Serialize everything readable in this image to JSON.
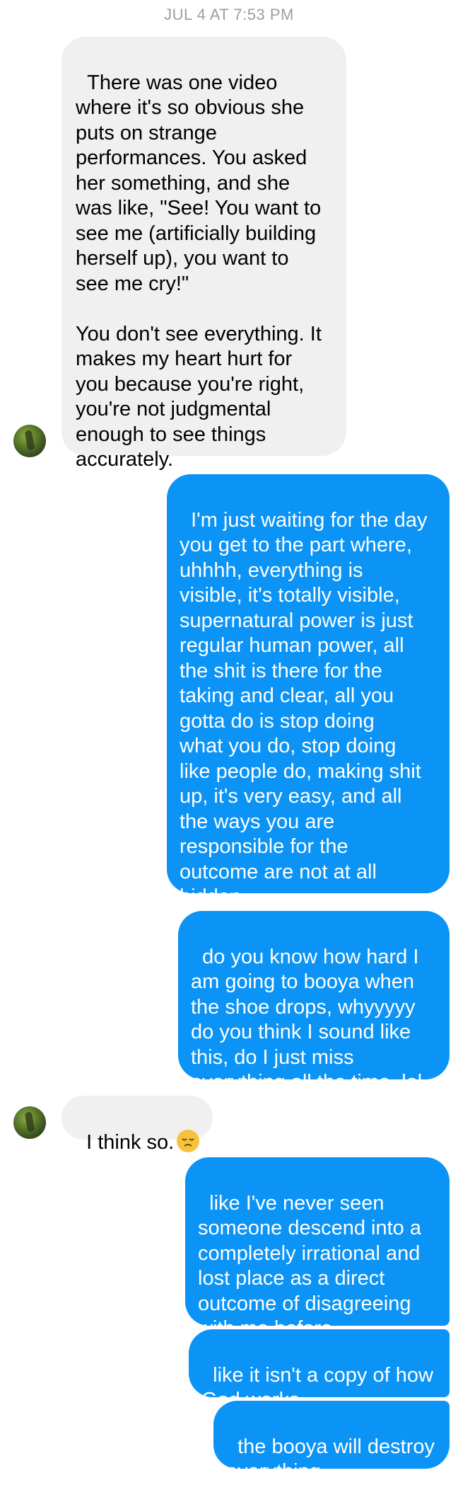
{
  "thread": {
    "timestamp": "JUL 4 AT 7:53 PM"
  },
  "messages": [
    {
      "direction": "incoming",
      "text": "There was one video\nwhere it's so obvious she\nputs on strange\nperformances. You asked\nher something, and she\nwas like, \"See! You want to\nsee me (artificially building\nherself up), you want to\nsee me cry!\"\n\nYou don't see everything. It\nmakes my heart hurt for\nyou because you're right,\nyou're not judgmental\nenough to see things\naccurately."
    },
    {
      "direction": "outgoing",
      "text": "I'm just waiting for the day\nyou get to the part where,\nuhhhh, everything is\nvisible, it's totally visible,\nsupernatural power is just\nregular human power, all\nthe shit is there for the\ntaking and clear, all you\ngotta do is stop doing\nwhat you do, stop doing\nlike people do, making shit\nup, it's very easy, and all\nthe ways you are\nresponsible for the\noutcome are not at all\nhidden"
    },
    {
      "direction": "outgoing",
      "text": "do you know how hard I\nam going to booya when\nthe shoe drops, whyyyyy\ndo you think I sound like\nthis, do I just miss\neverything all the time, lol"
    },
    {
      "direction": "incoming",
      "text": "I think so.",
      "emoji": "disappointed-face"
    },
    {
      "direction": "outgoing",
      "text": "like I've never seen\nsomeone descend into a\ncompletely irrational and\nlost place as a direct\noutcome of disagreeing\nwith me before"
    },
    {
      "direction": "outgoing",
      "text": "like it isn't a copy of how\nGod works"
    },
    {
      "direction": "outgoing",
      "text": "the booya will destroy\neverything"
    }
  ],
  "colors": {
    "outgoing_bubble": "#0b93f6",
    "incoming_bubble": "#f0f0f0",
    "timestamp_text": "#9e9e9e"
  }
}
